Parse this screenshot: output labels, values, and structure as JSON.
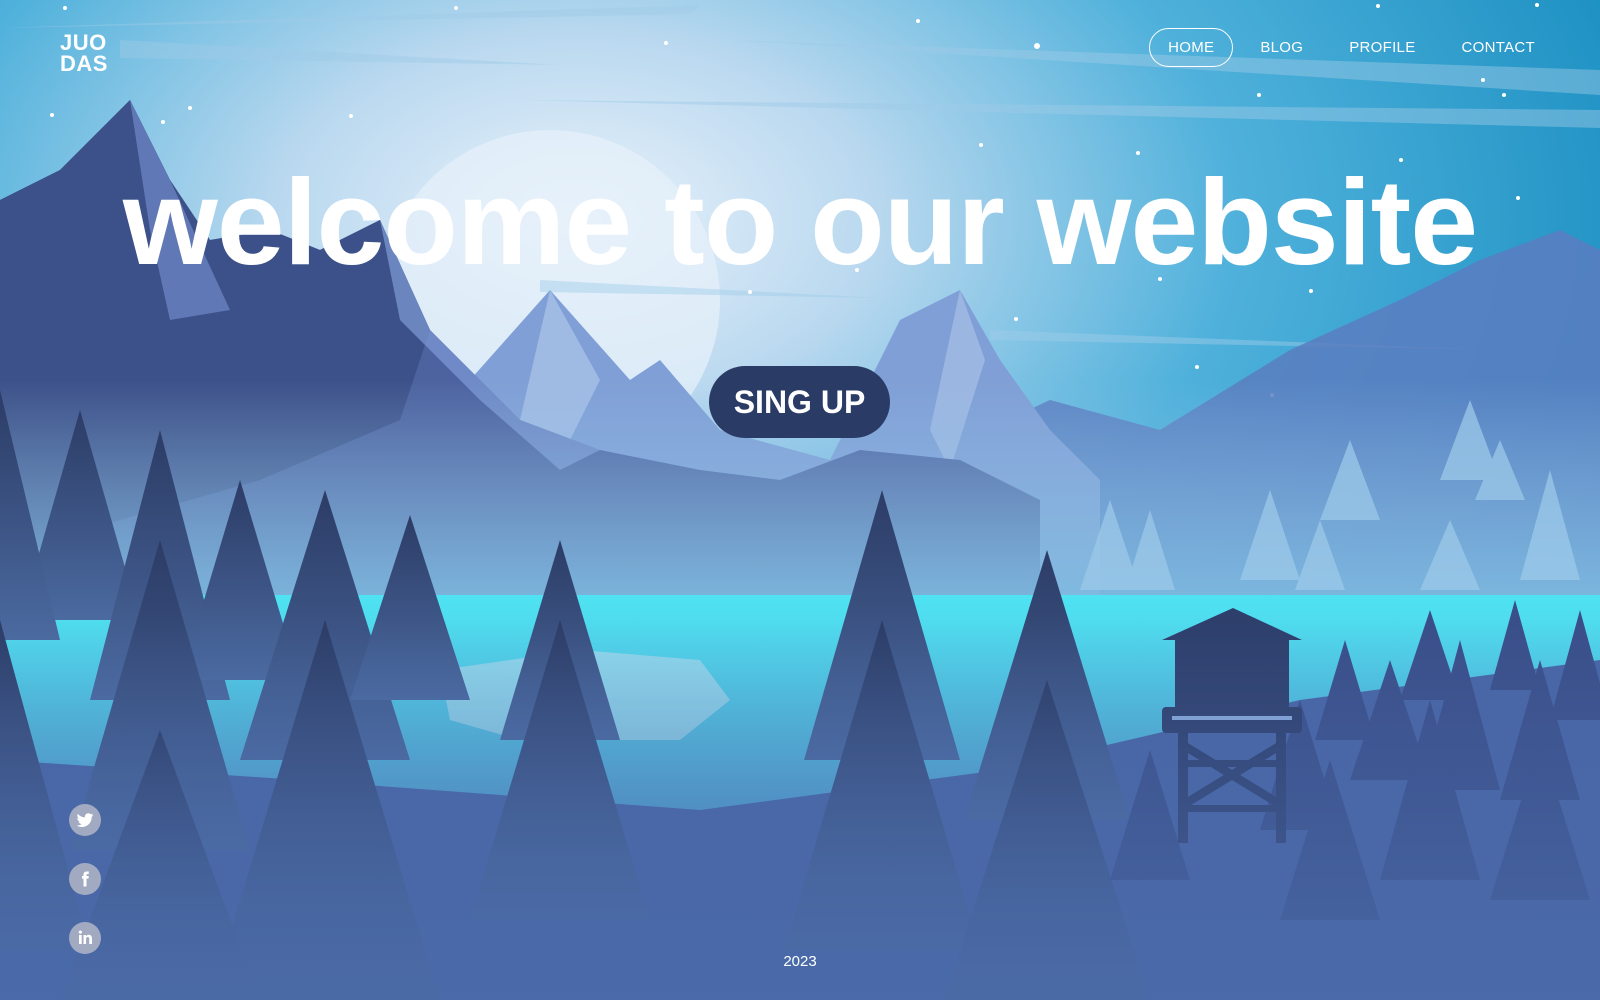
{
  "logo": {
    "line1": "JUO",
    "line2": "DAS"
  },
  "nav": {
    "items": [
      {
        "label": "HOME",
        "active": true
      },
      {
        "label": "BLOG",
        "active": false
      },
      {
        "label": "PROFILE",
        "active": false
      },
      {
        "label": "CONTACT",
        "active": false
      }
    ]
  },
  "hero": {
    "headline": "welcome to our website",
    "cta_label": "SING UP"
  },
  "socials": [
    {
      "icon": "twitter-icon"
    },
    {
      "icon": "facebook-icon"
    },
    {
      "icon": "linkedin-icon"
    }
  ],
  "footer": {
    "year": "2023"
  },
  "colors": {
    "sky_top": "#1a8cc0",
    "sky_glow": "#dbe9f7",
    "lake": "#3ad7ec",
    "button_bg": "#2a3b66",
    "tree_dark": "#2b3a62",
    "social_icon_bg": "#a2aac2"
  }
}
